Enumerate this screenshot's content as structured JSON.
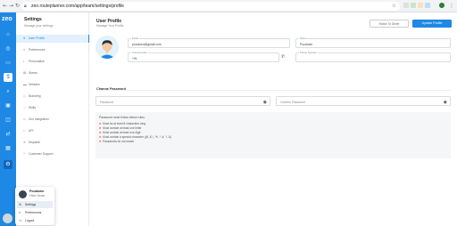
{
  "browser": {
    "url": "zeo.routeplanner.com/app/team/settings/profile",
    "lock_icon": "lock-icon",
    "star_icon": "star-icon"
  },
  "rail": {
    "logo": "zeo",
    "icons": [
      "home-icon",
      "globe-icon",
      "folder-icon",
      "dollar-icon",
      "search-icon",
      "truck-icon",
      "box-icon",
      "route-icon",
      "chart-icon",
      "settings-icon"
    ]
  },
  "sidebar": {
    "title": "Settings",
    "subtitle": "Manage your settings",
    "items": [
      {
        "label": "User Profile",
        "icon": "user-icon"
      },
      {
        "label": "Preferences",
        "icon": "sliders-icon"
      },
      {
        "label": "Personalize",
        "icon": "palette-icon"
      },
      {
        "label": "Stores",
        "icon": "store-icon"
      },
      {
        "label": "Vehicles",
        "icon": "car-icon"
      },
      {
        "label": "Branding",
        "icon": "tag-icon"
      },
      {
        "label": "Skills",
        "icon": "star-icon"
      },
      {
        "label": "Zeo Integration",
        "icon": "link-icon"
      },
      {
        "label": "API",
        "icon": "code-icon"
      },
      {
        "label": "Dispatch",
        "icon": "send-icon"
      },
      {
        "label": "Customer Support",
        "icon": "help-icon"
      }
    ]
  },
  "popup": {
    "name": "Poudown",
    "role": "Fleet Owner",
    "items": [
      {
        "label": "Settings",
        "icon": "gear-icon"
      },
      {
        "label": "Preferences",
        "icon": "sliders-icon"
      },
      {
        "label": "Logout",
        "icon": "logout-icon"
      }
    ]
  },
  "main": {
    "title": "User Profile",
    "subtitle": "Manage Your Profile",
    "switch_label": "Switch To Driver",
    "update_label": "Update Profile",
    "fields": {
      "email": {
        "label": "Email",
        "value": "poudown@gmail.com"
      },
      "name": {
        "label": "Name",
        "value": "Poudown"
      },
      "country": {
        "label": "Country/code",
        "value": "+91"
      },
      "phone": {
        "label": "Phone Number",
        "value": ""
      }
    },
    "change_password": "Change Password",
    "password_placeholder": "Password",
    "confirm_placeholder": "Confirm Password",
    "rules_title": "Password must follow below rules.",
    "rules": [
      "Must be at least 8 characters long",
      "Must contain at least one letter",
      "Must contain at least one digit",
      "Must contain a special character (@, $, !, %, *, #, ?, &)",
      "Passwords do not match"
    ]
  },
  "colors": {
    "accent": "#1e88e5",
    "error": "#e53935"
  }
}
